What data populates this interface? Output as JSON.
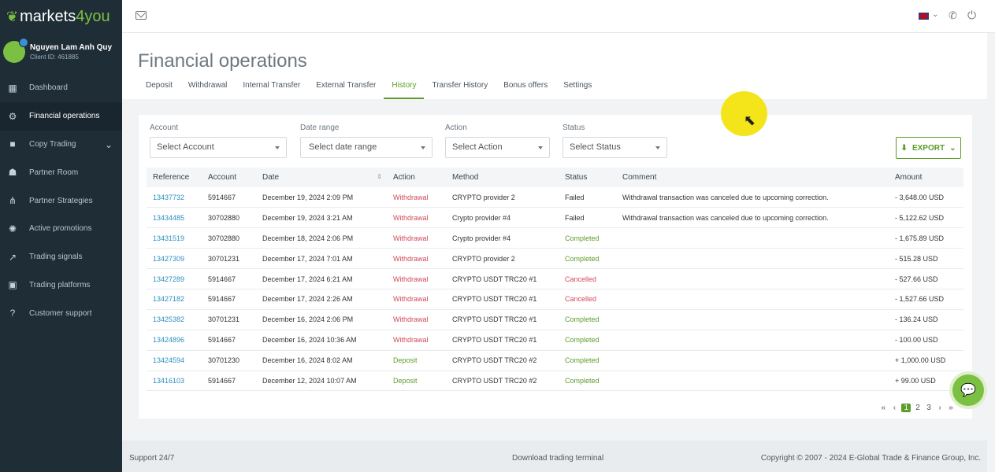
{
  "brand": {
    "name_main": "markets",
    "name_accent": "4you"
  },
  "user": {
    "name": "Nguyen Lam Anh Quy",
    "client_id": "Client ID: 461885"
  },
  "sidebar": {
    "items": [
      {
        "label": "Dashboard",
        "icon": "dashboard-icon"
      },
      {
        "label": "Financial operations",
        "icon": "gear-icon"
      },
      {
        "label": "Copy Trading",
        "icon": "briefcase-icon"
      },
      {
        "label": "Partner Room",
        "icon": "partner-icon"
      },
      {
        "label": "Partner Strategies",
        "icon": "network-icon"
      },
      {
        "label": "Active promotions",
        "icon": "megaphone-icon"
      },
      {
        "label": "Trading signals",
        "icon": "chart-icon"
      },
      {
        "label": "Trading platforms",
        "icon": "monitor-icon"
      },
      {
        "label": "Customer support",
        "icon": "help-icon"
      }
    ]
  },
  "header": {
    "title": "Financial operations"
  },
  "tabs": [
    "Deposit",
    "Withdrawal",
    "Internal Transfer",
    "External Transfer",
    "History",
    "Transfer History",
    "Bonus offers",
    "Settings"
  ],
  "filters": {
    "account": {
      "label": "Account",
      "placeholder": "Select Account"
    },
    "date": {
      "label": "Date range",
      "placeholder": "Select date range"
    },
    "action": {
      "label": "Action",
      "placeholder": "Select Action"
    },
    "status": {
      "label": "Status",
      "placeholder": "Select Status"
    },
    "export_label": "EXPORT"
  },
  "table": {
    "columns": [
      "Reference",
      "Account",
      "Date",
      "Action",
      "Method",
      "Status",
      "Comment",
      "Amount"
    ],
    "rows": [
      {
        "ref": "13437732",
        "account": "5914667",
        "date": "December 19, 2024 2:09 PM",
        "action": "Withdrawal",
        "method": "CRYPTO provider 2",
        "status": "Failed",
        "comment": "Withdrawal transaction was canceled due to upcoming correction.",
        "amount": "- 3,648.00 USD"
      },
      {
        "ref": "13434485",
        "account": "30702880",
        "date": "December 19, 2024 3:21 AM",
        "action": "Withdrawal",
        "method": "Crypto provider #4",
        "status": "Failed",
        "comment": "Withdrawal transaction was canceled due to upcoming correction.",
        "amount": "- 5,122.62 USD"
      },
      {
        "ref": "13431519",
        "account": "30702880",
        "date": "December 18, 2024 2:06 PM",
        "action": "Withdrawal",
        "method": "Crypto provider #4",
        "status": "Completed",
        "comment": "",
        "amount": "- 1,675.89 USD"
      },
      {
        "ref": "13427309",
        "account": "30701231",
        "date": "December 17, 2024 7:01 AM",
        "action": "Withdrawal",
        "method": "CRYPTO provider 2",
        "status": "Completed",
        "comment": "",
        "amount": "- 515.28 USD"
      },
      {
        "ref": "13427289",
        "account": "5914667",
        "date": "December 17, 2024 6:21 AM",
        "action": "Withdrawal",
        "method": "CRYPTO USDT TRC20 #1",
        "status": "Cancelled",
        "comment": "",
        "amount": "- 527.66 USD"
      },
      {
        "ref": "13427182",
        "account": "5914667",
        "date": "December 17, 2024 2:26 AM",
        "action": "Withdrawal",
        "method": "CRYPTO USDT TRC20 #1",
        "status": "Cancelled",
        "comment": "",
        "amount": "- 1,527.66 USD"
      },
      {
        "ref": "13425382",
        "account": "30701231",
        "date": "December 16, 2024 2:06 PM",
        "action": "Withdrawal",
        "method": "CRYPTO USDT TRC20 #1",
        "status": "Completed",
        "comment": "",
        "amount": "- 136.24 USD"
      },
      {
        "ref": "13424896",
        "account": "5914667",
        "date": "December 16, 2024 10:36 AM",
        "action": "Withdrawal",
        "method": "CRYPTO USDT TRC20 #1",
        "status": "Completed",
        "comment": "",
        "amount": "- 100.00 USD"
      },
      {
        "ref": "13424594",
        "account": "30701230",
        "date": "December 16, 2024 8:02 AM",
        "action": "Deposit",
        "method": "CRYPTO USDT TRC20 #2",
        "status": "Completed",
        "comment": "",
        "amount": "+ 1,000.00 USD"
      },
      {
        "ref": "13416103",
        "account": "5914667",
        "date": "December 12, 2024 10:07 AM",
        "action": "Deposit",
        "method": "CRYPTO USDT TRC20 #2",
        "status": "Completed",
        "comment": "",
        "amount": "+ 99.00 USD"
      }
    ]
  },
  "pagination": {
    "pages": [
      "1",
      "2",
      "3"
    ],
    "current": "1"
  },
  "footer": {
    "support": "Support 24/7",
    "download": "Download trading terminal",
    "copyright": "Copyright © 2007 - 2024 E-Global Trade & Finance Group, Inc."
  },
  "colors": {
    "accent": "#5d9c2a",
    "sidebar": "#1f2d37",
    "link": "#2f8fc0",
    "danger": "#d14a5a"
  }
}
